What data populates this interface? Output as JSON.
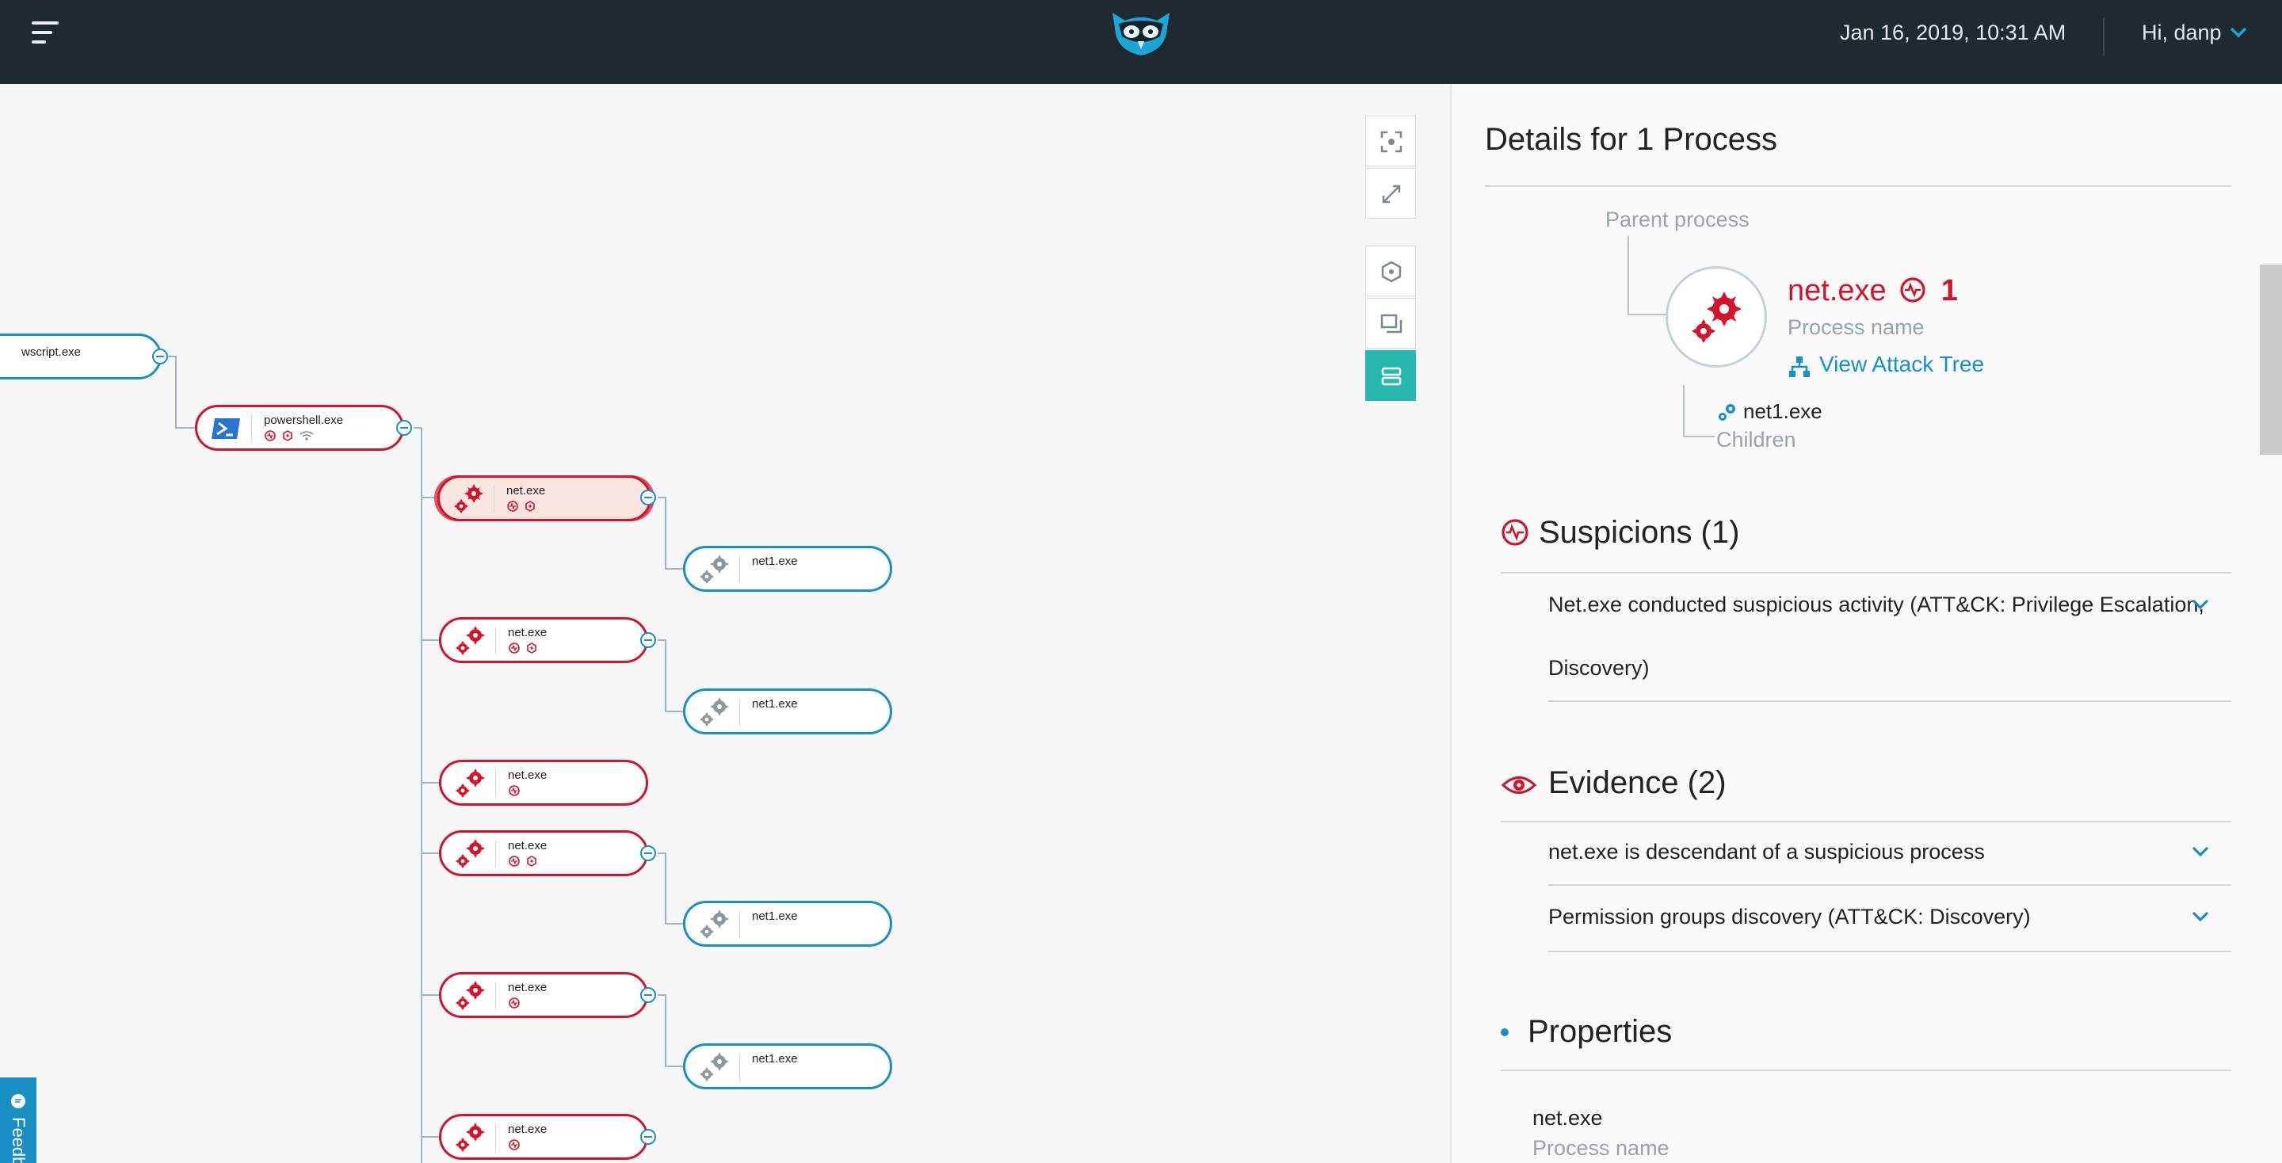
{
  "header": {
    "datetime": "Jan 16, 2019, 10:31 AM",
    "user_greeting": "Hi, danp",
    "colors": {
      "bar": "#1f2a30",
      "accent": "#1a8fc4",
      "danger": "#d0142b"
    }
  },
  "tree": {
    "nodes": [
      {
        "name": "wscript.exe",
        "kind": "script",
        "status": "neutral"
      },
      {
        "name": "powershell.exe",
        "kind": "powershell",
        "status": "malicious"
      },
      {
        "name": "net.exe",
        "kind": "gear",
        "status": "malicious",
        "selected": true
      },
      {
        "name": "net1.exe",
        "kind": "gear",
        "status": "neutral"
      },
      {
        "name": "net.exe",
        "kind": "gear",
        "status": "malicious"
      },
      {
        "name": "net1.exe",
        "kind": "gear",
        "status": "neutral"
      },
      {
        "name": "net.exe",
        "kind": "gear",
        "status": "malicious"
      },
      {
        "name": "net.exe",
        "kind": "gear",
        "status": "malicious"
      },
      {
        "name": "net1.exe",
        "kind": "gear",
        "status": "neutral"
      },
      {
        "name": "net.exe",
        "kind": "gear",
        "status": "malicious"
      },
      {
        "name": "net1.exe",
        "kind": "gear",
        "status": "neutral"
      },
      {
        "name": "net.exe",
        "kind": "gear",
        "status": "malicious"
      }
    ],
    "toolbar": [
      "focus-icon",
      "expand-icon",
      "hexagon-icon",
      "windows-icon",
      "list-icon"
    ],
    "feedback_label": "Feedback"
  },
  "details": {
    "title": "Details for 1 Process",
    "parent_label": "Parent process",
    "process_name": "net.exe",
    "suspicion_count": "1",
    "process_name_label": "Process name",
    "attack_tree_link": "View Attack Tree",
    "child_name": "net1.exe",
    "children_label": "Children",
    "suspicions": {
      "title": "Suspicions (1)",
      "items": [
        "Net.exe conducted suspicious activity (ATT&CK: Privilege Escalation,",
        "Discovery)"
      ]
    },
    "evidence": {
      "title": "Evidence (2)",
      "items": [
        "net.exe is descendant of a suspicious process",
        "Permission groups discovery (ATT&CK: Discovery)"
      ]
    },
    "properties": {
      "title": "Properties",
      "name_value": "net.exe",
      "name_label": "Process name"
    }
  }
}
